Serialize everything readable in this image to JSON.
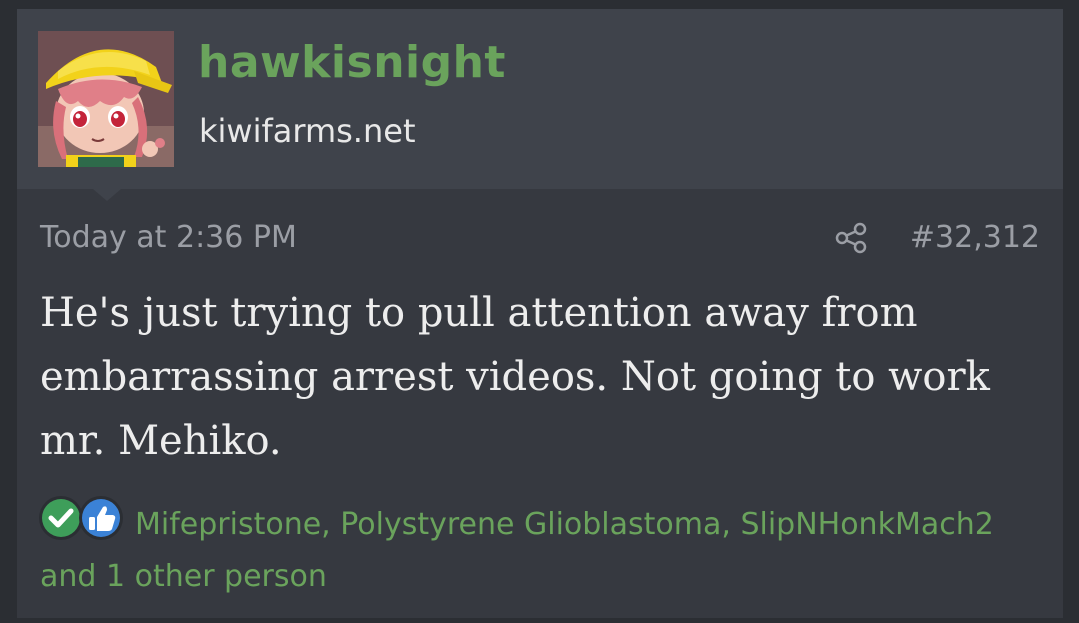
{
  "user": {
    "name": "hawkisnight",
    "site": "kiwifarms.net"
  },
  "post": {
    "timestamp": "Today at 2:36 PM",
    "number": "#32,312",
    "text": "He's just trying to pull attention away from embarrassing arrest videos. Not going to work mr. Mehiko."
  },
  "reactions": {
    "icons": [
      "check-icon",
      "thumbs-up-icon"
    ],
    "text": "Mifepristone, Polystyrene Glioblastoma, SlipNHonkMach2 and 1 other person"
  },
  "colors": {
    "accent_green": "#6aa35c",
    "card_bg": "#363940",
    "header_bg": "#3f434b",
    "page_bg": "#2b2e33",
    "check_green": "#3e9e5a",
    "like_blue": "#3b82d6"
  }
}
